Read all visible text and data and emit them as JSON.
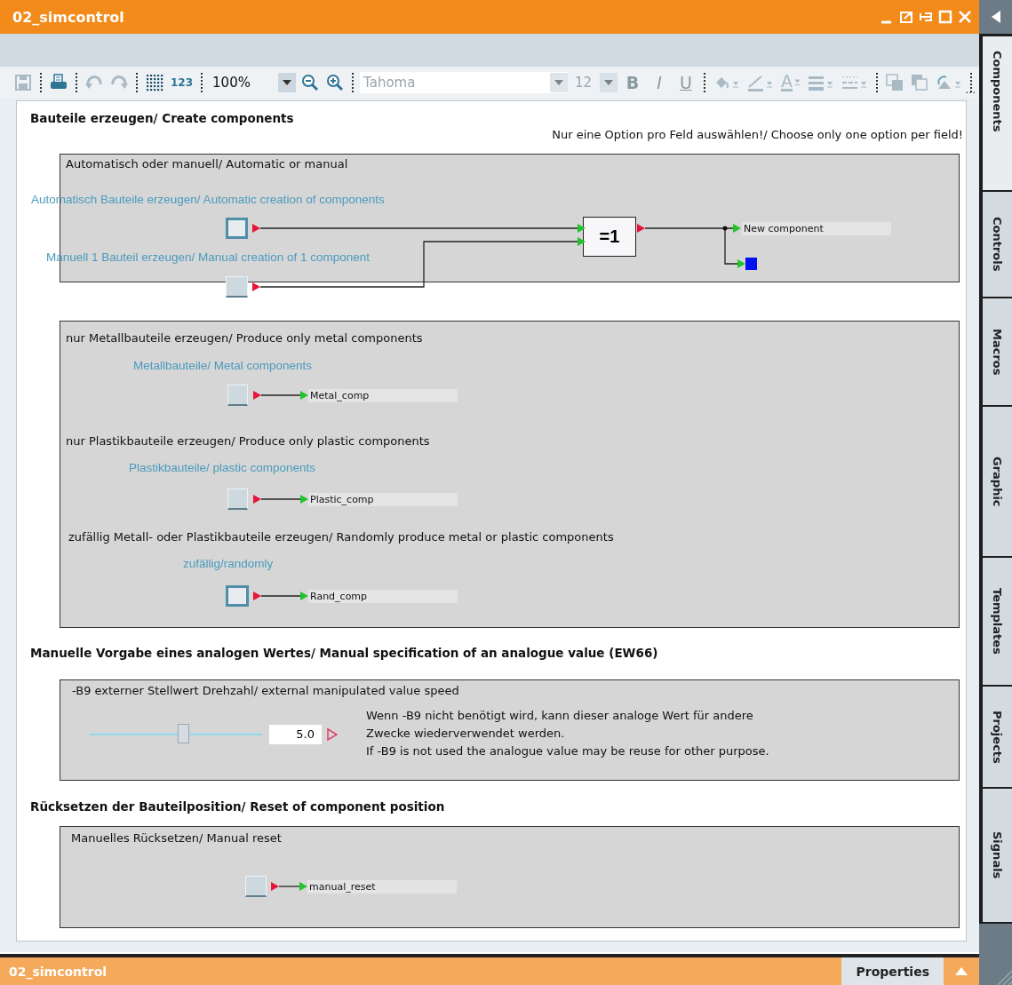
{
  "window": {
    "title": "02_simcontrol"
  },
  "window_controls": [
    {
      "kind": "minimize"
    },
    {
      "kind": "undock"
    },
    {
      "kind": "pin"
    },
    {
      "kind": "maximize"
    },
    {
      "kind": "close"
    }
  ],
  "toolbar": [
    {
      "kind": "save",
      "disabled": true
    },
    {
      "kind": "separator"
    },
    {
      "kind": "print",
      "disabled": false
    },
    {
      "kind": "separator"
    },
    {
      "kind": "undo",
      "disabled": true
    },
    {
      "kind": "redo",
      "disabled": true
    },
    {
      "kind": "separator"
    },
    {
      "kind": "grid",
      "disabled": false
    },
    {
      "kind": "text",
      "label": "123",
      "disabled": false
    },
    {
      "kind": "separator"
    },
    {
      "kind": "zoom_combo",
      "value": "100%",
      "disabled": false
    },
    {
      "kind": "zoom_out",
      "disabled": false
    },
    {
      "kind": "zoom_in",
      "disabled": false
    },
    {
      "kind": "separator"
    },
    {
      "kind": "font_combo",
      "value": "Tahoma",
      "disabled": true
    },
    {
      "kind": "size_combo",
      "value": "12",
      "disabled": true
    },
    {
      "kind": "bold",
      "label": "B",
      "disabled": true
    },
    {
      "kind": "italic",
      "label": "I",
      "disabled": true
    },
    {
      "kind": "underline",
      "label": "U",
      "disabled": true
    },
    {
      "kind": "separator"
    },
    {
      "kind": "fill",
      "disabled": true
    },
    {
      "kind": "line_color",
      "disabled": true
    },
    {
      "kind": "font_color",
      "label": "A",
      "disabled": true
    },
    {
      "kind": "align",
      "disabled": true
    },
    {
      "kind": "dash",
      "disabled": true
    },
    {
      "kind": "separator"
    },
    {
      "kind": "front",
      "disabled": true
    },
    {
      "kind": "back",
      "disabled": true
    },
    {
      "kind": "rotate",
      "disabled": true
    },
    {
      "kind": "separator"
    }
  ],
  "toolbar_overflow": "...",
  "screen": {
    "heading_create": "Bauteile erzeugen/ Create components",
    "note": "Nur eine Option pro Feld auswählen!/ Choose only one option per field!",
    "auto_manual": {
      "title": "Automatisch oder manuell/ Automatic or manual",
      "inputs": [
        {
          "label": "Automatisch Bauteile erzeugen/ Automatic creation of components",
          "active": true
        },
        {
          "label": "Manuell 1 Bauteil erzeugen/ Manual creation of 1 component",
          "active": false
        }
      ],
      "gate": "=1",
      "output": "New component"
    },
    "material": {
      "options": [
        {
          "title": "nur Metallbauteile erzeugen/ Produce only metal components",
          "label": "Metallbauteile/ Metal components",
          "active": false,
          "signal": "Metal_comp"
        },
        {
          "title": "nur Plastikbauteile erzeugen/ Produce only plastic components",
          "label": "Plastikbauteile/ plastic components",
          "active": false,
          "signal": "Plastic_comp"
        },
        {
          "title": "zufällig Metall- oder Plastikbauteile erzeugen/ Randomly produce metal or plastic components",
          "label": "zufällig/randomly",
          "active": true,
          "signal": "Rand_comp"
        }
      ]
    },
    "heading_analog": "Manuelle Vorgabe eines analogen Wertes/ Manual specification of an analogue value (EW66)",
    "analog": {
      "title": "-B9 externer Stellwert Drehzahl/ external manipulated value speed",
      "level": 0.54,
      "value": "5.0",
      "lines": [
        "Wenn -B9 nicht benötigt wird, kann dieser analoge Wert für andere",
        "Zwecke wiederverwendet werden.",
        "If -B9 is not used the analogue value may be reuse for other purpose."
      ]
    },
    "heading_reset": "Rücksetzen der Bauteilposition/ Reset of component position",
    "reset": {
      "title": "Manuelles Rücksetzen/ Manual reset",
      "active": false,
      "signal": "manual_reset"
    }
  },
  "sidebar_tabs": [
    {
      "label": "Components",
      "selected": true
    },
    {
      "label": "Controls",
      "selected": false
    },
    {
      "label": "Macros",
      "selected": false
    },
    {
      "label": "Graphic",
      "selected": false
    },
    {
      "label": "Templates",
      "selected": false
    },
    {
      "label": "Projects",
      "selected": false
    },
    {
      "label": "Signals",
      "selected": false
    }
  ],
  "bottom_bar": {
    "title": "02_simcontrol",
    "button": "Properties"
  }
}
